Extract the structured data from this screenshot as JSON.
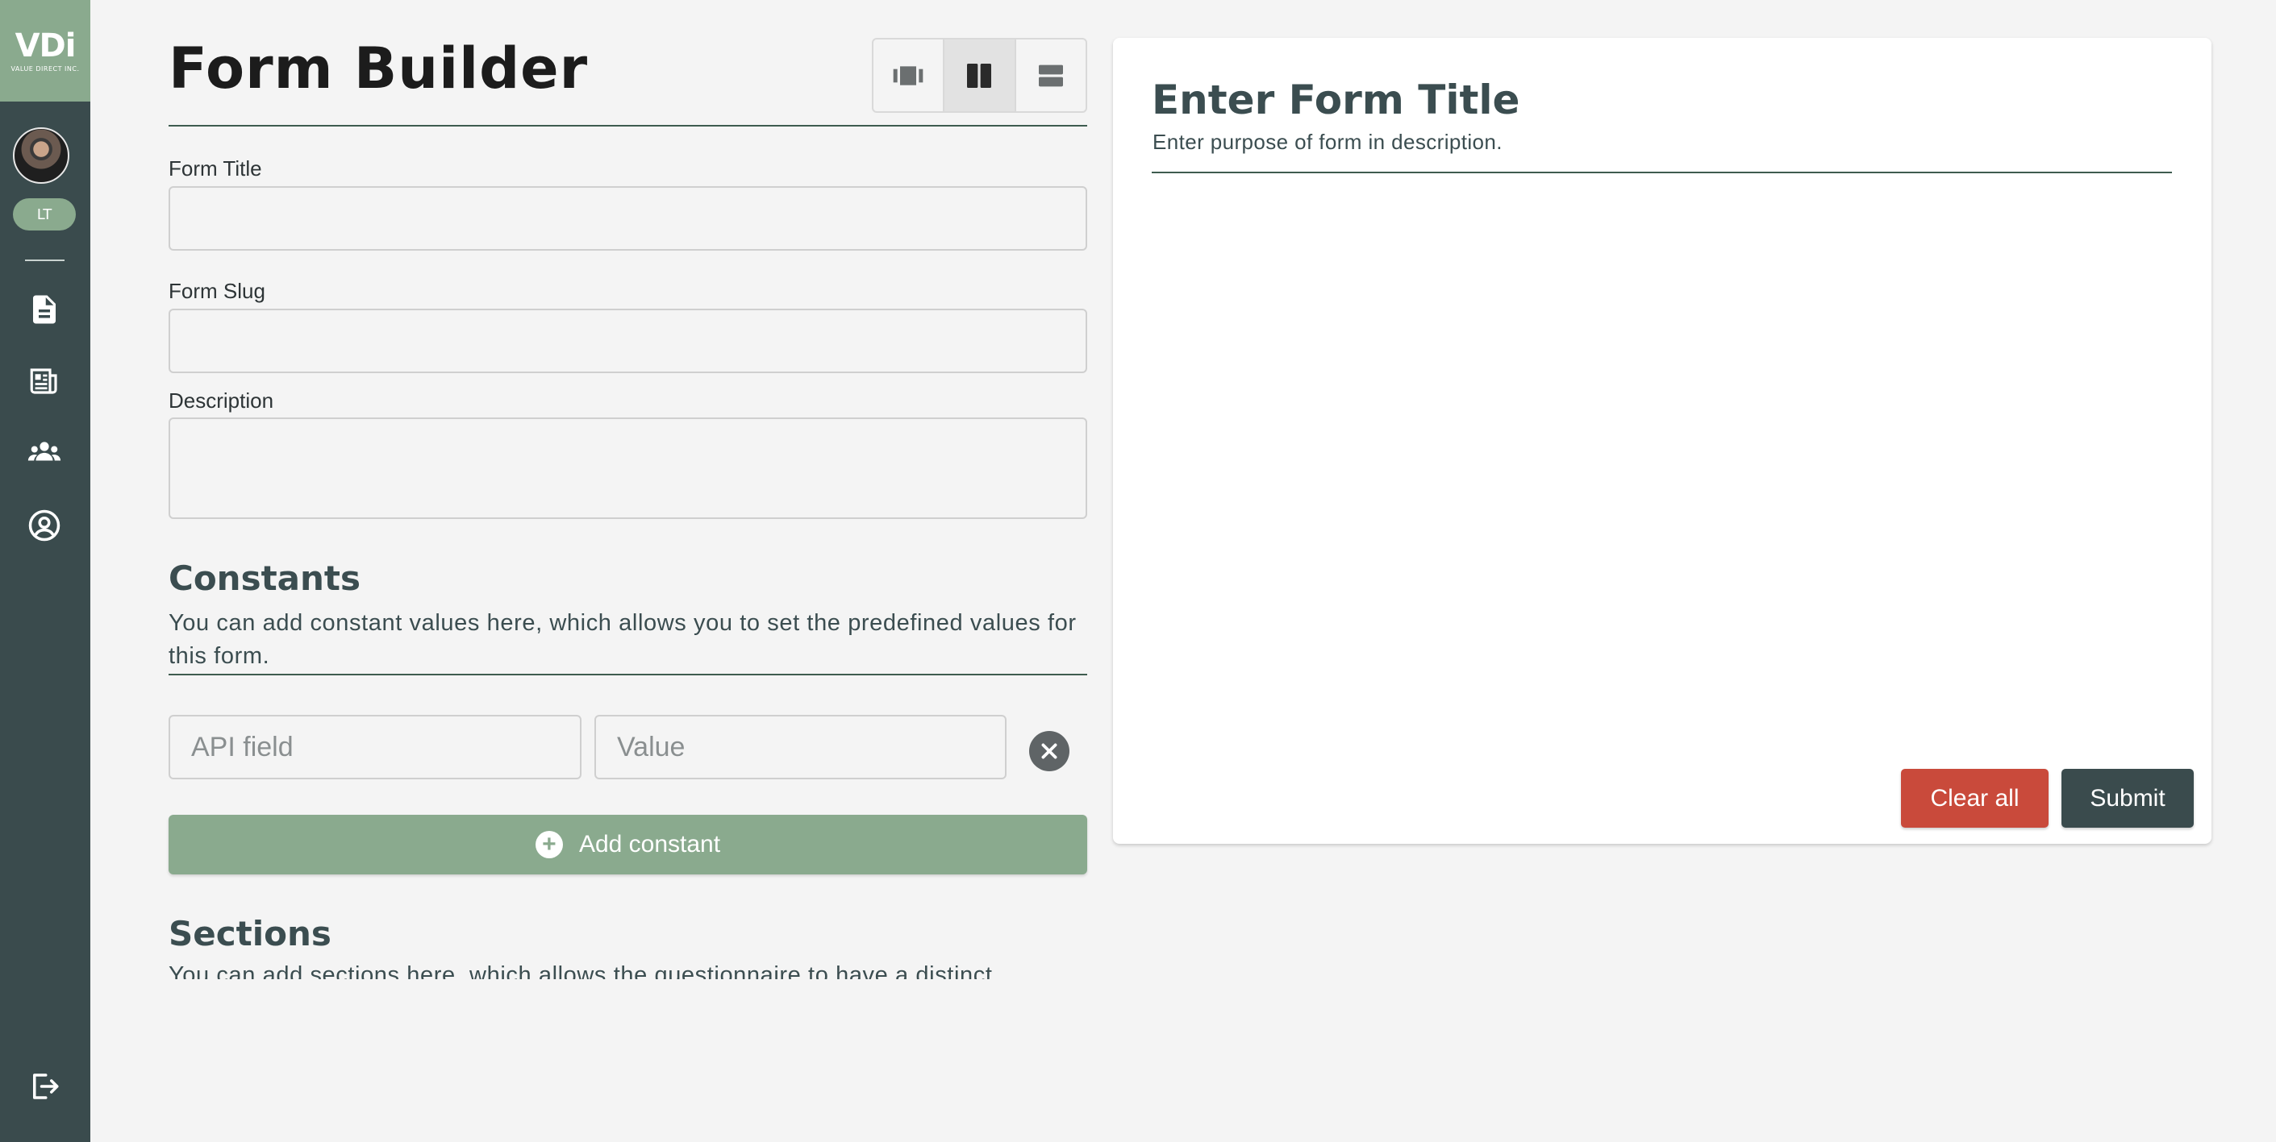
{
  "sidebar": {
    "logo_text": "VDi",
    "logo_subtext": "VALUE DIRECT INC.",
    "user_initials": "LT",
    "nav": [
      {
        "icon": "document-icon"
      },
      {
        "icon": "newspaper-icon"
      },
      {
        "icon": "users-icon"
      },
      {
        "icon": "user-circle-icon"
      }
    ],
    "logout_icon": "logout-icon"
  },
  "builder": {
    "title": "Form Builder",
    "view_modes": [
      "horizontal-view-icon",
      "split-view-icon",
      "stacked-view-icon"
    ],
    "active_view": "split-view-icon",
    "fields": {
      "form_title_label": "Form Title",
      "form_title_value": "",
      "form_slug_label": "Form Slug",
      "form_slug_value": "",
      "description_label": "Description",
      "description_value": ""
    },
    "constants": {
      "heading": "Constants",
      "description": "You can add constant values here, which allows you to set the predefined values for this form.",
      "api_field_placeholder": "API field",
      "value_placeholder": "Value",
      "add_button_label": "Add constant"
    },
    "sections": {
      "heading": "Sections",
      "description": "You can add sections here, which allows the questionnaire to have a distinct"
    }
  },
  "preview": {
    "title": "Enter Form Title",
    "description": "Enter purpose of form in description.",
    "clear_label": "Clear all",
    "submit_label": "Submit"
  },
  "colors": {
    "sidebar": "#3a4b4d",
    "accent_green": "#8aaa8e",
    "danger": "#c94a3b",
    "dark_button": "#3a4b4d",
    "background": "#f4f4f4"
  }
}
